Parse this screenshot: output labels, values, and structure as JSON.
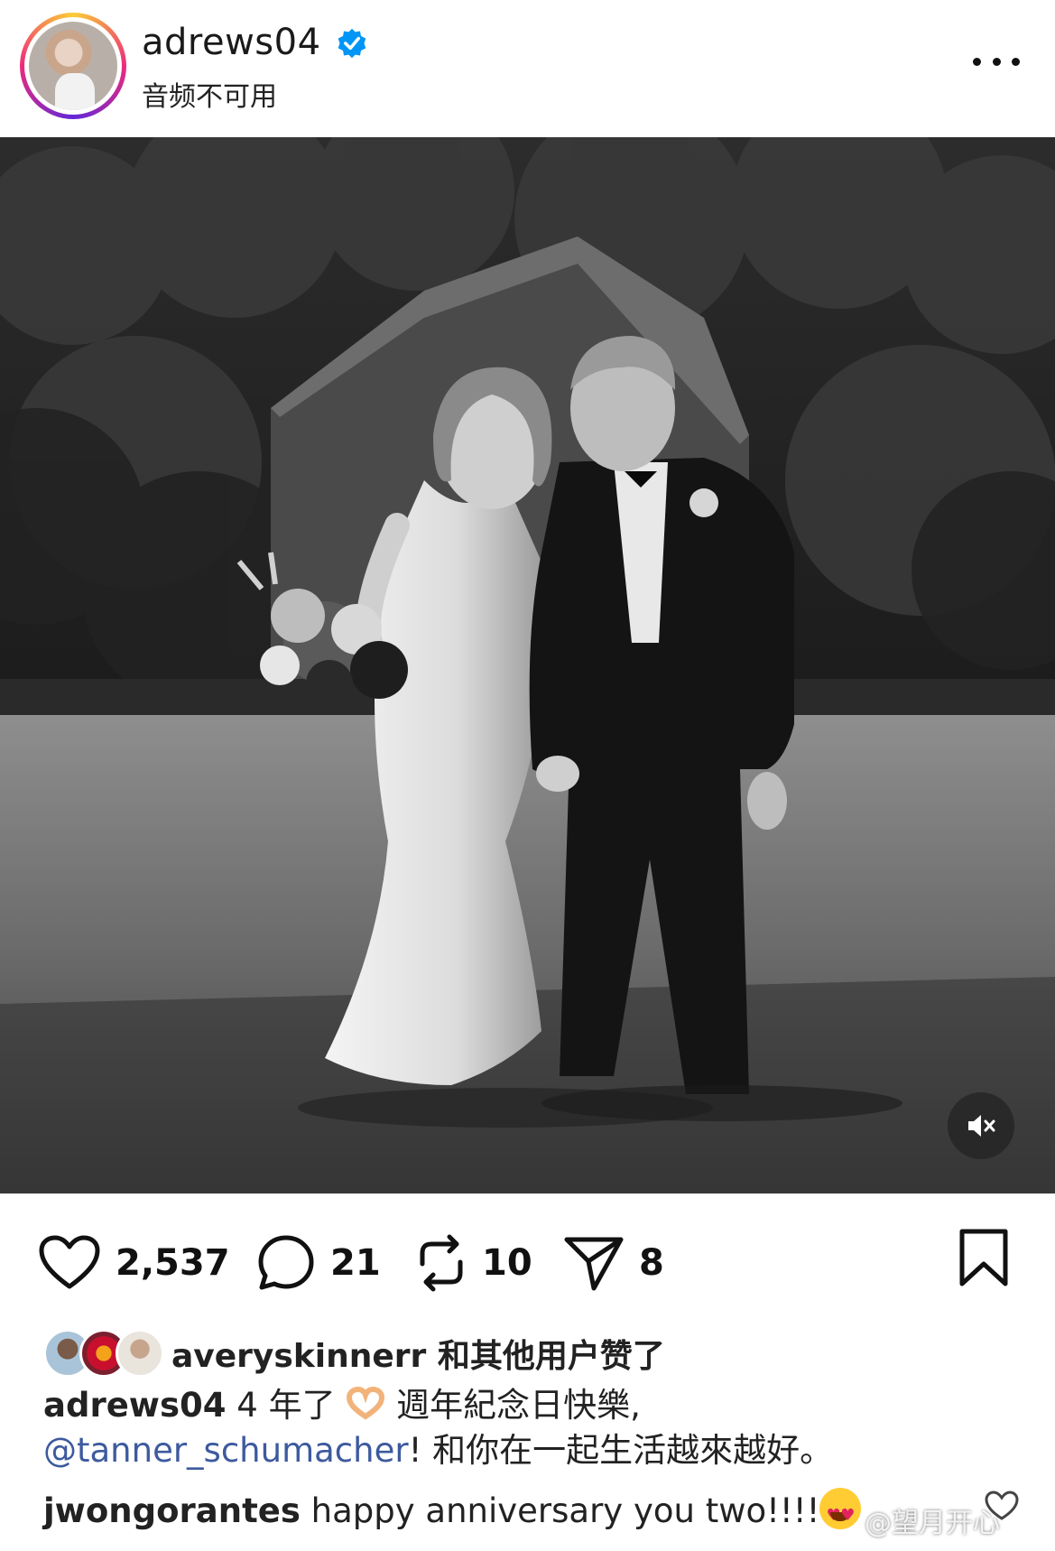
{
  "header": {
    "username": "adrews04",
    "subtitle": "音频不可用",
    "verified_icon": "verified-badge-icon",
    "more_icon": "more-options-icon"
  },
  "post": {
    "image_description_icon": "photo",
    "mute_icon": "speaker-muted-icon"
  },
  "actions": {
    "likes": "2,537",
    "comments": "21",
    "reposts": "10",
    "shares": "8",
    "icons": [
      "heart-icon",
      "comment-icon",
      "repost-icon",
      "share-icon",
      "bookmark-icon"
    ]
  },
  "liked_by": {
    "text": "averyskinnerr 和其他用户赞了"
  },
  "caption": {
    "username": "adrews04",
    "text_before": " 4 年了 ",
    "text_mid": " 週年紀念日快樂,",
    "mention": "@tanner_schumacher",
    "text_after": "! 和你在一起生活越來越好。"
  },
  "comment": {
    "username": "jwongorantes",
    "text": " happy anniversary you two!!!!"
  },
  "watermark": {
    "text": "@望月开心"
  },
  "colors": {
    "verified_blue": "#0095f6",
    "mention_blue": "#3d5a9e",
    "text": "#111111"
  }
}
